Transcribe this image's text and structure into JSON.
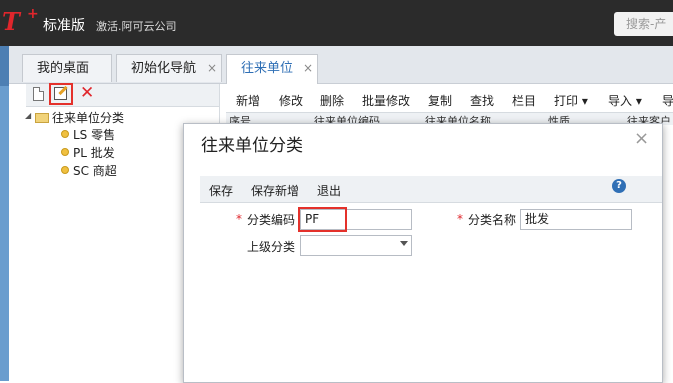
{
  "header": {
    "logo_text": "T",
    "logo_plus": "+",
    "edition": "标准版",
    "activation": "激活.阿可云公司",
    "search_placeholder": "搜索-产"
  },
  "tabs": [
    {
      "label": "我的桌面",
      "closable": false,
      "active": false
    },
    {
      "label": "初始化导航",
      "closable": true,
      "active": false
    },
    {
      "label": "往来单位",
      "closable": true,
      "active": true
    }
  ],
  "close_glyph": "×",
  "tree": {
    "root": "往来单位分类",
    "children": [
      "LS 零售",
      "PL 批发",
      "SC 商超"
    ]
  },
  "toolbar": {
    "items": [
      "新增",
      "修改",
      "删除",
      "批量修改",
      "复制",
      "查找",
      "栏目",
      "打印 ▾",
      "导入 ▾",
      "导"
    ]
  },
  "grid_headers": [
    "序号",
    "往来单位编码",
    "往来单位名称",
    "性质",
    "往来客户"
  ],
  "dialog": {
    "title": "往来单位分类",
    "close": "×",
    "toolbar": [
      "保存",
      "保存新增",
      "退出"
    ],
    "help": "?",
    "fields": {
      "code_label": "分类编码",
      "code_value": "PF",
      "name_label": "分类名称",
      "name_value": "批发",
      "parent_label": "上级分类",
      "parent_value": ""
    },
    "required_mark": "*"
  },
  "colors": {
    "topbar": "#2b2b2b",
    "brand_red": "#e0262c",
    "active_tab_text": "#2f6fb5",
    "highlight_box": "#e4312b",
    "side_strip": "#6a9dce"
  }
}
